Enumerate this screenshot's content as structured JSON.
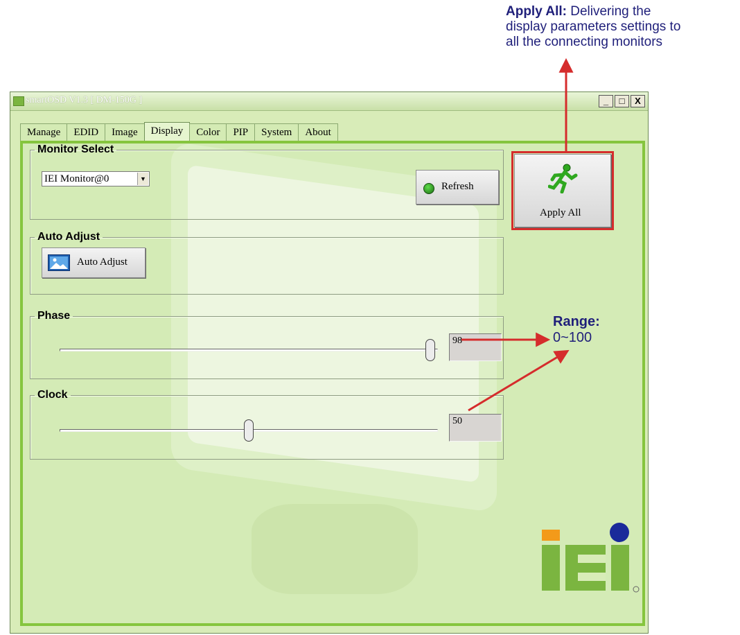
{
  "callout_apply": {
    "title": "Apply All:",
    "text_1": "Delivering the",
    "text_2": "display parameters settings to",
    "text_3": "all the connecting monitors"
  },
  "callout_range": {
    "title": "Range:",
    "value": "0~100"
  },
  "window": {
    "title": "smartOSD V1.3 [ DM-150G ]",
    "controls": {
      "minimize": "_",
      "maximize": "□",
      "close": "X"
    }
  },
  "tabs": [
    "Manage",
    "EDID",
    "Image",
    "Display",
    "Color",
    "PIP",
    "System",
    "About"
  ],
  "active_tab": "Display",
  "monitor_select": {
    "label": "Monitor Select",
    "selected": "IEI Monitor@0",
    "refresh_label": "Refresh"
  },
  "auto_adjust": {
    "label": "Auto Adjust",
    "button_label": "Auto Adjust"
  },
  "phase": {
    "label": "Phase",
    "value": "98",
    "level": 0.98
  },
  "clock": {
    "label": "Clock",
    "value": "50",
    "level": 0.5
  },
  "apply_all": {
    "label": "Apply All"
  },
  "colors": {
    "window_bg": "#d8ecb8",
    "panel_border": "#85c53e",
    "annotation": "#d52c2c",
    "callout_text": "#1f1f7a",
    "logo_green": "#7bb540",
    "logo_orange": "#f39a1a",
    "logo_blue": "#1a2a9a"
  },
  "icons": {
    "title": "iei-logo-icon",
    "refresh": "green-led-icon",
    "auto_adjust": "picture-icon",
    "apply_all": "running-man-icon",
    "select_arrow": "chevron-down-icon"
  },
  "logo_text": "iEi"
}
